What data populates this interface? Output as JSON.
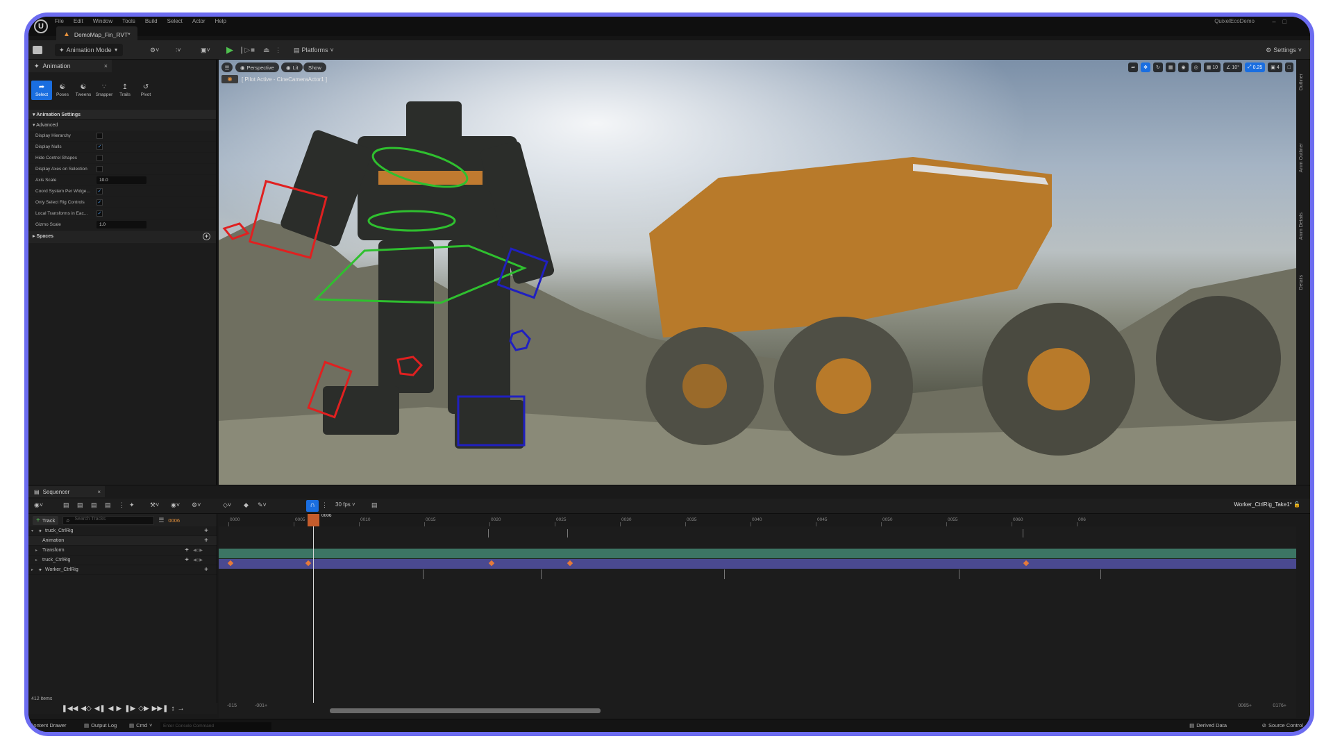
{
  "menubar": {
    "items": [
      "File",
      "Edit",
      "Window",
      "Tools",
      "Build",
      "Select",
      "Actor",
      "Help"
    ],
    "project": "QuixelEcoDemo",
    "level_tab": "DemoMap_Fin_RVT*"
  },
  "toolbar": {
    "mode_label": "Animation Mode",
    "platforms_label": "Platforms",
    "settings_label": "Settings"
  },
  "left_panel": {
    "tab_label": "Animation",
    "tools": [
      {
        "label": "Select",
        "icon": "cursor-icon"
      },
      {
        "label": "Poses",
        "icon": "poses-icon"
      },
      {
        "label": "Tweens",
        "icon": "tweens-icon"
      },
      {
        "label": "Snapper",
        "icon": "snapper-icon"
      },
      {
        "label": "Trails",
        "icon": "trails-icon"
      },
      {
        "label": "Pivot",
        "icon": "pivot-icon"
      }
    ],
    "section_title": "Animation Settings",
    "subsection_title": "Advanced",
    "props": [
      {
        "label": "Display Hierarchy",
        "checked": false
      },
      {
        "label": "Display Nulls",
        "checked": true
      },
      {
        "label": "Hide Control Shapes",
        "checked": false
      },
      {
        "label": "Display Axes on Selection",
        "checked": false
      },
      {
        "label": "Axis Scale",
        "value": "10.0"
      },
      {
        "label": "Coord System Per Widge...",
        "checked": true
      },
      {
        "label": "Only Select Rig Controls",
        "checked": true
      },
      {
        "label": "Local Transforms in Eac...",
        "checked": true
      },
      {
        "label": "Gizmo Scale",
        "value": "1.0"
      }
    ],
    "spaces_label": "Spaces"
  },
  "viewport": {
    "perspective_label": "Perspective",
    "lit_label": "Lit",
    "show_label": "Show",
    "pilot_label": "[ Pilot Active - CineCameraActor1 ]",
    "grid_snap": "10",
    "rot_snap": "10°",
    "scale_snap": "0.25",
    "camera_speed": "4"
  },
  "right_strip": {
    "tabs": [
      "Outliner",
      "Anim Outliner",
      "Anim Details",
      "Details"
    ]
  },
  "sequencer": {
    "tab_label": "Sequencer",
    "fps_label": "30 fps",
    "sequence_name": "Worker_CtrlRig_Take1*",
    "add_track_label": "Track",
    "search_placeholder": "Search Tracks",
    "current_frame": "0006",
    "tracks": [
      {
        "name": "truck_CtrlRig",
        "level": 0
      },
      {
        "name": "Animation",
        "level": 1
      },
      {
        "name": "Transform",
        "level": 1
      },
      {
        "name": "truck_CtrlRig",
        "level": 1
      },
      {
        "name": "Worker_CtrlRig",
        "level": 0
      }
    ],
    "items_count": "412 items",
    "ruler": [
      "0000",
      "0005",
      "0010",
      "0015",
      "0020",
      "0025",
      "0030",
      "0035",
      "0040",
      "0045",
      "0050",
      "0055",
      "0060",
      "006"
    ],
    "playhead_label": "0006",
    "range_start": "-015",
    "range_in": "-001+",
    "range_out": "0065+",
    "range_end": "0176+"
  },
  "statusbar": {
    "content_drawer": "Content Drawer",
    "output_log": "Output Log",
    "cmd": "Cmd",
    "console_placeholder": "Enter Console Command",
    "derived_data": "Derived Data",
    "source_control": "Source Control"
  },
  "colors": {
    "accent": "#1a6ee0",
    "frame_border": "#6c6cf0",
    "anim_lane": "#3c7564",
    "ctrl_lane": "#4a4990",
    "keyframe": "#e57a3a",
    "playhead": "#c55c2c"
  }
}
